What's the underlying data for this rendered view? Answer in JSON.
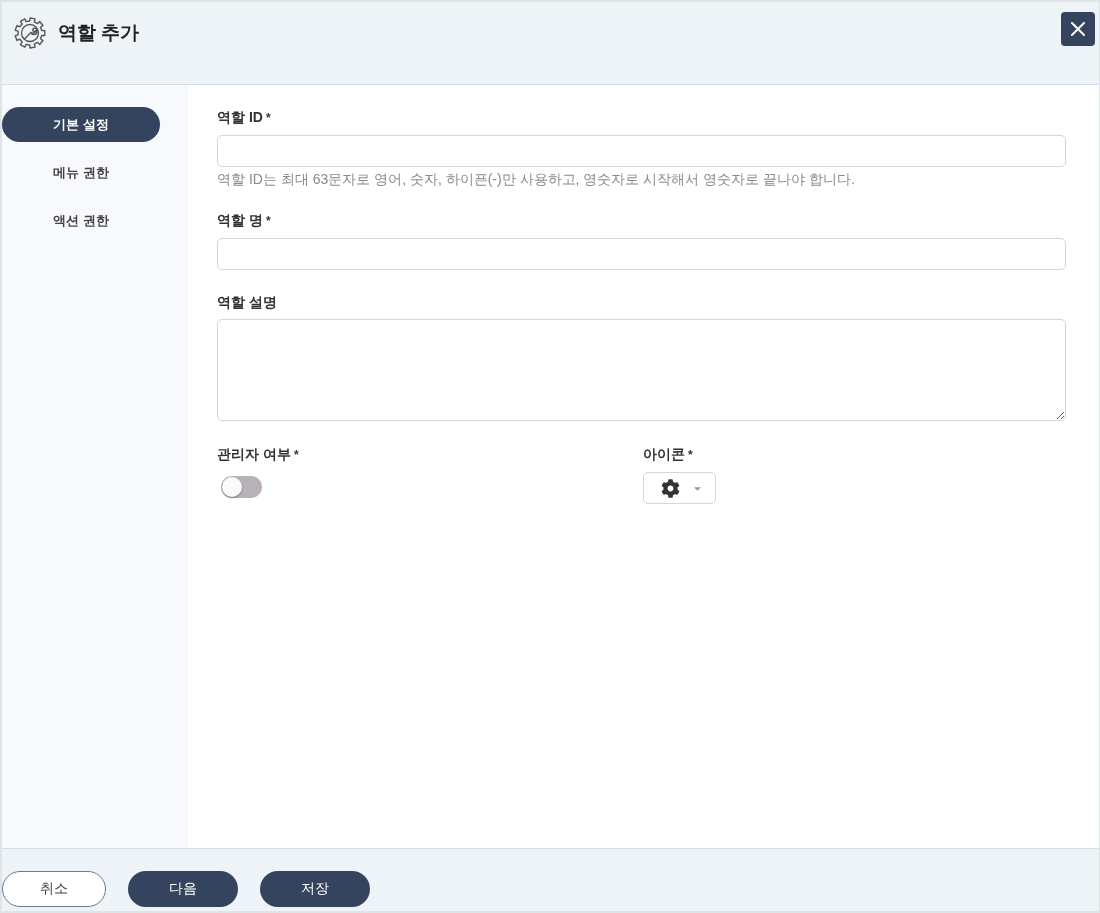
{
  "dialog": {
    "title": "역할 추가"
  },
  "sidebar": {
    "items": [
      {
        "label": "기본 설정",
        "selected": true
      },
      {
        "label": "메뉴 권한",
        "selected": false
      },
      {
        "label": "액션 권한",
        "selected": false
      }
    ]
  },
  "form": {
    "fields": [
      {
        "kind": "text",
        "label": "역할 ID",
        "required_mark": "*",
        "help": "역할 ID는 최대 63문자로 영어, 숫자, 하이픈(-)만 사용하고, 영숫자로 시작해서 영숫자로 끝나야 합니다."
      },
      {
        "kind": "text",
        "label": "역할 명",
        "required_mark": "*"
      },
      {
        "kind": "textarea",
        "label": "역할 설명"
      }
    ],
    "options": [
      {
        "kind": "toggle",
        "label": "관리자 여부",
        "required_mark": "*",
        "on": false
      },
      {
        "kind": "icon_select",
        "label": "아이콘",
        "required_mark": "*"
      }
    ]
  },
  "footer": {
    "buttons": [
      {
        "kind": "outline",
        "label": "취소"
      },
      {
        "kind": "primary",
        "label": "다음"
      },
      {
        "kind": "primary",
        "label": "저장"
      }
    ]
  }
}
